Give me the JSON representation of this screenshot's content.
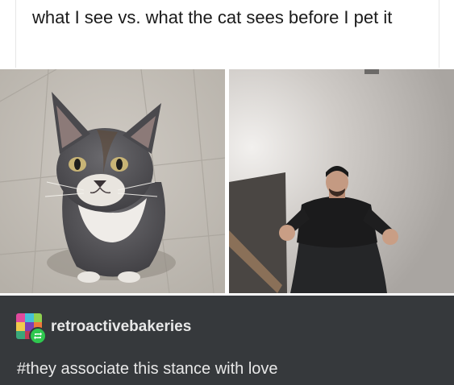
{
  "caption": {
    "text": "what I see vs. what the cat sees before I pet it"
  },
  "post": {
    "username": "retroactivebakeries",
    "tags": "#they associate this stance with love"
  },
  "colors": {
    "dark_bar": "#36393c",
    "reblog_badge": "#2fc84f"
  },
  "icons": {
    "avatar": "colorful-avatar-icon",
    "reblog": "reblog-icon"
  }
}
